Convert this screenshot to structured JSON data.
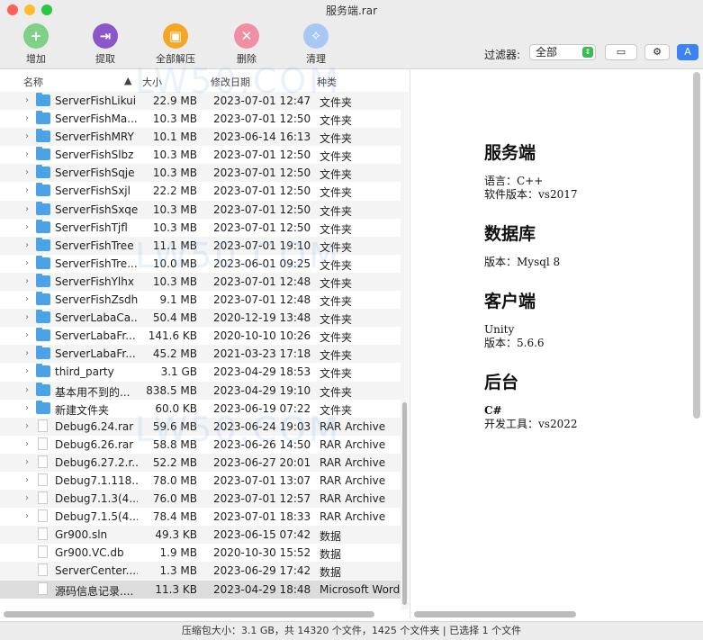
{
  "window": {
    "title": "服务端.rar"
  },
  "toolbar": {
    "add": "增加",
    "extract": "提取",
    "extract_all": "全部解压",
    "delete": "删除",
    "clean": "清理",
    "filter_label": "过滤器:",
    "filter_value": "全部"
  },
  "columns": {
    "name": "名称",
    "size": "大小",
    "date": "修改日期",
    "kind": "种类"
  },
  "files": [
    {
      "name": "ServerFishLikui",
      "size": "22.9 MB",
      "date": "2023-07-01 12:47",
      "kind": "文件夹",
      "type": "folder"
    },
    {
      "name": "ServerFishMa...",
      "size": "10.3 MB",
      "date": "2023-07-01 12:50",
      "kind": "文件夹",
      "type": "folder"
    },
    {
      "name": "ServerFishMRY",
      "size": "10.1 MB",
      "date": "2023-06-14 16:13",
      "kind": "文件夹",
      "type": "folder"
    },
    {
      "name": "ServerFishSlbz",
      "size": "10.3 MB",
      "date": "2023-07-01 12:50",
      "kind": "文件夹",
      "type": "folder"
    },
    {
      "name": "ServerFishSqje",
      "size": "10.3 MB",
      "date": "2023-07-01 12:50",
      "kind": "文件夹",
      "type": "folder"
    },
    {
      "name": "ServerFishSxjl",
      "size": "22.2 MB",
      "date": "2023-07-01 12:50",
      "kind": "文件夹",
      "type": "folder"
    },
    {
      "name": "ServerFishSxqe",
      "size": "10.3 MB",
      "date": "2023-07-01 12:50",
      "kind": "文件夹",
      "type": "folder"
    },
    {
      "name": "ServerFishTjfl",
      "size": "10.3 MB",
      "date": "2023-07-01 12:50",
      "kind": "文件夹",
      "type": "folder"
    },
    {
      "name": "ServerFishTree",
      "size": "11.1 MB",
      "date": "2023-07-01 19:10",
      "kind": "文件夹",
      "type": "folder"
    },
    {
      "name": "ServerFishTre...",
      "size": "10.0 MB",
      "date": "2023-06-01 09:25",
      "kind": "文件夹",
      "type": "folder"
    },
    {
      "name": "ServerFishYlhx",
      "size": "10.3 MB",
      "date": "2023-07-01 12:48",
      "kind": "文件夹",
      "type": "folder"
    },
    {
      "name": "ServerFishZsdh",
      "size": "9.1 MB",
      "date": "2023-07-01 12:48",
      "kind": "文件夹",
      "type": "folder"
    },
    {
      "name": "ServerLabaCa...",
      "size": "50.4 MB",
      "date": "2020-12-19 13:48",
      "kind": "文件夹",
      "type": "folder"
    },
    {
      "name": "ServerLabaFr...",
      "size": "141.6 KB",
      "date": "2020-10-10 10:26",
      "kind": "文件夹",
      "type": "folder"
    },
    {
      "name": "ServerLabaFr...",
      "size": "45.2 MB",
      "date": "2021-03-23 17:18",
      "kind": "文件夹",
      "type": "folder"
    },
    {
      "name": "third_party",
      "size": "3.1 GB",
      "date": "2023-04-29 18:53",
      "kind": "文件夹",
      "type": "folder"
    },
    {
      "name": "基本用不到的...",
      "size": "838.5 MB",
      "date": "2023-04-29 19:10",
      "kind": "文件夹",
      "type": "folder"
    },
    {
      "name": "新建文件夹",
      "size": "60.0 KB",
      "date": "2023-06-19 07:22",
      "kind": "文件夹",
      "type": "folder"
    },
    {
      "name": "Debug6.24.rar",
      "size": "59.6 MB",
      "date": "2023-06-24 19:03",
      "kind": "RAR Archive",
      "type": "archive"
    },
    {
      "name": "Debug6.26.rar",
      "size": "58.8 MB",
      "date": "2023-06-26 14:50",
      "kind": "RAR Archive",
      "type": "archive"
    },
    {
      "name": "Debug6.27.2.r...",
      "size": "52.2 MB",
      "date": "2023-06-27 20:01",
      "kind": "RAR Archive",
      "type": "archive"
    },
    {
      "name": "Debug7.1.118....",
      "size": "78.0 MB",
      "date": "2023-07-01 13:07",
      "kind": "RAR Archive",
      "type": "archive"
    },
    {
      "name": "Debug7.1.3(4...",
      "size": "76.0 MB",
      "date": "2023-07-01 12:57",
      "kind": "RAR Archive",
      "type": "archive"
    },
    {
      "name": "Debug7.1.5(4...",
      "size": "78.4 MB",
      "date": "2023-07-01 18:33",
      "kind": "RAR Archive",
      "type": "archive"
    },
    {
      "name": "Gr900.sln",
      "size": "49.3 KB",
      "date": "2023-06-15 07:42",
      "kind": "数据",
      "type": "file"
    },
    {
      "name": "Gr900.VC.db",
      "size": "1.9 MB",
      "date": "2020-10-30 15:52",
      "kind": "数据",
      "type": "file"
    },
    {
      "name": "ServerCenter....",
      "size": "1.3 MB",
      "date": "2023-06-29 17:42",
      "kind": "数据",
      "type": "file"
    },
    {
      "name": "源码信息记录....",
      "size": "11.3 KB",
      "date": "2023-04-29 18:48",
      "kind": "Microsoft Word",
      "type": "file",
      "selected": true
    }
  ],
  "preview": {
    "s1_title": "服务端",
    "s1_l1": "语言：C++",
    "s1_l2": "软件版本：vs2017",
    "s2_title": "数据库",
    "s2_l1": "版本：Mysql 8",
    "s3_title": "客户端",
    "s3_l1": "Unity",
    "s3_l2": "版本：5.6.6",
    "s4_title": "后台",
    "s4_l1": "C#",
    "s4_l2": "开发工具：vs2022"
  },
  "status": {
    "text": "压缩包大小：3.1 GB，共 14320 个文件，1425 个文件夹 | 已选择 1 个文件"
  },
  "watermark": {
    "text": "LW50.COM"
  },
  "colors": {
    "add": "#7ed08a",
    "extract": "#8a56c9",
    "extract_all": "#f5a623",
    "delete": "#f08fa3",
    "clean": "#a7c8f2",
    "folder": "#4ba3e6"
  }
}
